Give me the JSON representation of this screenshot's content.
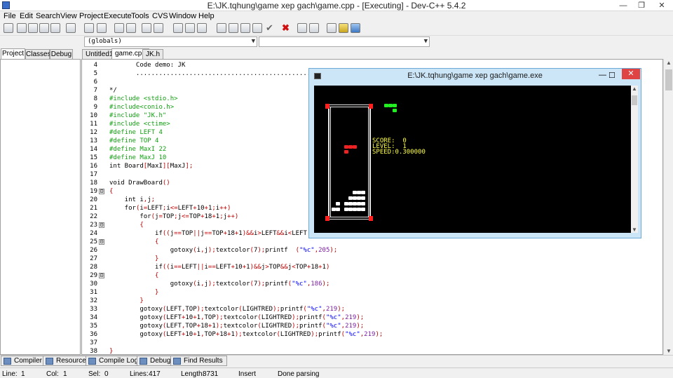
{
  "window": {
    "title": "E:\\JK.tqhung\\game xep gach\\game.cpp - [Executing] - Dev-C++ 5.4.2",
    "min": "—",
    "max": "❐",
    "close": "✕"
  },
  "menus": [
    "File",
    "Edit",
    "Search",
    "View",
    "Project",
    "Execute",
    "Tools",
    "CVS",
    "Window",
    "Help"
  ],
  "combos": {
    "scope": "(globals)",
    "members": ""
  },
  "left_tabs": [
    "Project",
    "Classes",
    "Debug"
  ],
  "editor_tabs": [
    "Untitled1",
    "game.cpp",
    "JK.h"
  ],
  "code_lines": [
    {
      "n": "4",
      "fold": "",
      "html": "       Code demo: JK"
    },
    {
      "n": "5",
      "fold": "",
      "html": "       ..............................................."
    },
    {
      "n": "6",
      "fold": "",
      "html": ""
    },
    {
      "n": "7",
      "fold": "",
      "html": "*/"
    },
    {
      "n": "8",
      "fold": "",
      "html": "<span class='pp'>#include &lt;stdio.h&gt;</span>"
    },
    {
      "n": "9",
      "fold": "",
      "html": "<span class='pp'>#include&lt;conio.h&gt;</span>"
    },
    {
      "n": "10",
      "fold": "",
      "html": "<span class='pp'>#include \"JK.h\"</span>"
    },
    {
      "n": "11",
      "fold": "",
      "html": "<span class='pp'>#include &lt;ctime&gt;</span>"
    },
    {
      "n": "12",
      "fold": "",
      "html": "<span class='pp'>#define LEFT 4</span>"
    },
    {
      "n": "13",
      "fold": "",
      "html": "<span class='pp'>#define TOP 4</span>"
    },
    {
      "n": "14",
      "fold": "",
      "html": "<span class='pp'>#define MaxI 22</span>"
    },
    {
      "n": "15",
      "fold": "",
      "html": "<span class='pp'>#define MaxJ 10</span>"
    },
    {
      "n": "16",
      "fold": "",
      "html": "int Board<span class='op'>[</span>MaxI<span class='op'>][</span>MaxJ<span class='op'>];</span>"
    },
    {
      "n": "17",
      "fold": "",
      "html": ""
    },
    {
      "n": "18",
      "fold": "",
      "html": "void DrawBoard<span class='op'>()</span>"
    },
    {
      "n": "19",
      "fold": "⊟",
      "html": "<span class='op'>{</span>"
    },
    {
      "n": "20",
      "fold": "",
      "html": "    int i<span class='op'>,</span>j<span class='op'>;</span>"
    },
    {
      "n": "21",
      "fold": "",
      "html": "    for<span class='op'>(</span>i<span class='op'>=</span>LEFT<span class='op'>;</span>i<span class='op'>&lt;=</span>LEFT<span class='op'>+</span>10<span class='op'>+</span>1<span class='op'>;</span>i<span class='op'>++)</span>"
    },
    {
      "n": "22",
      "fold": "",
      "html": "        for<span class='op'>(</span>j<span class='op'>=</span>TOP<span class='op'>;</span>j<span class='op'>&lt;=</span>TOP<span class='op'>+</span>18<span class='op'>+</span>1<span class='op'>;</span>j<span class='op'>++)</span>"
    },
    {
      "n": "23",
      "fold": "⊟",
      "html": "        <span class='op'>{</span>"
    },
    {
      "n": "24",
      "fold": "",
      "html": "            if<span class='op'>((</span>j<span class='op'>==</span>TOP<span class='op'>||</span>j<span class='op'>==</span>TOP<span class='op'>+</span>18<span class='op'>+</span>1<span class='op'>)&amp;&amp;</span>i<span class='op'>&gt;</span>LEFT<span class='op'>&amp;&amp;</span>i<span class='op'>&lt;</span>LEFT"
    },
    {
      "n": "25",
      "fold": "⊟",
      "html": "            <span class='op'>{</span>"
    },
    {
      "n": "26",
      "fold": "",
      "html": "                gotoxy<span class='op'>(</span>i<span class='op'>,</span>j<span class='op'>);</span>textcolor<span class='op'>(</span>7<span class='op'>);</span>printf  <span class='op'>(</span><span class='str'>\"%c\"</span><span class='op'>,</span><span class='num'>205</span><span class='op'>);</span>"
    },
    {
      "n": "27",
      "fold": "",
      "html": "            <span class='op'>}</span>"
    },
    {
      "n": "28",
      "fold": "",
      "html": "            if<span class='op'>((</span>i<span class='op'>==</span>LEFT<span class='op'>||</span>i<span class='op'>==</span>LEFT<span class='op'>+</span>10<span class='op'>+</span>1<span class='op'>)&amp;&amp;</span>j<span class='op'>&gt;</span>TOP<span class='op'>&amp;&amp;</span>j<span class='op'>&lt;</span>TOP<span class='op'>+</span>18<span class='op'>+</span>1<span class='op'>)</span>"
    },
    {
      "n": "29",
      "fold": "⊟",
      "html": "            <span class='op'>{</span>"
    },
    {
      "n": "30",
      "fold": "",
      "html": "                gotoxy<span class='op'>(</span>i<span class='op'>,</span>j<span class='op'>);</span>textcolor<span class='op'>(</span>7<span class='op'>);</span>printf<span class='op'>(</span><span class='str'>\"%c\"</span><span class='op'>,</span><span class='num'>186</span><span class='op'>);</span>"
    },
    {
      "n": "31",
      "fold": "",
      "html": "            <span class='op'>}</span>"
    },
    {
      "n": "32",
      "fold": "",
      "html": "        <span class='op'>}</span>"
    },
    {
      "n": "33",
      "fold": "",
      "html": "        gotoxy<span class='op'>(</span>LEFT<span class='op'>,</span>TOP<span class='op'>);</span>textcolor<span class='op'>(</span>LIGHTRED<span class='op'>);</span>printf<span class='op'>(</span><span class='str'>\"%c\"</span><span class='op'>,</span><span class='num'>219</span><span class='op'>);</span>"
    },
    {
      "n": "34",
      "fold": "",
      "html": "        gotoxy<span class='op'>(</span>LEFT<span class='op'>+</span>10<span class='op'>+</span>1<span class='op'>,</span>TOP<span class='op'>);</span>textcolor<span class='op'>(</span>LIGHTRED<span class='op'>);</span>printf<span class='op'>(</span><span class='str'>\"%c\"</span><span class='op'>,</span><span class='num'>219</span><span class='op'>);</span>"
    },
    {
      "n": "35",
      "fold": "",
      "html": "        gotoxy<span class='op'>(</span>LEFT<span class='op'>,</span>TOP<span class='op'>+</span>18<span class='op'>+</span>1<span class='op'>);</span>textcolor<span class='op'>(</span>LIGHTRED<span class='op'>);</span>printf<span class='op'>(</span><span class='str'>\"%c\"</span><span class='op'>,</span><span class='num'>219</span><span class='op'>);</span>"
    },
    {
      "n": "36",
      "fold": "",
      "html": "        gotoxy<span class='op'>(</span>LEFT<span class='op'>+</span>10<span class='op'>+</span>1<span class='op'>,</span>TOP<span class='op'>+</span>18<span class='op'>+</span>1<span class='op'>);</span>textcolor<span class='op'>(</span>LIGHTRED<span class='op'>);</span>printf<span class='op'>(</span><span class='str'>\"%c\"</span><span class='op'>,</span><span class='num'>219</span><span class='op'>);</span>"
    },
    {
      "n": "37",
      "fold": "",
      "html": ""
    },
    {
      "n": "38",
      "fold": "",
      "html": "<span class='op'>}</span>"
    }
  ],
  "console": {
    "title": "E:\\JK.tqhung\\game xep gach\\game.exe",
    "min": "—",
    "max": "☐",
    "close": "✕",
    "score_label": "SCORE:  0",
    "level_label": "LEVEL:  1",
    "speed_label": "SPEED:0.300000"
  },
  "bottom_tabs": [
    "Compiler",
    "Resources",
    "Compile Log",
    "Debug",
    "Find Results"
  ],
  "status": {
    "line_label": "Line:",
    "line": "1",
    "col_label": "Col:",
    "col": "1",
    "sel_label": "Sel:",
    "sel": "0",
    "lines_label": "Lines:",
    "lines": "417",
    "length_label": "Length:",
    "length": "8731",
    "mode": "Insert",
    "message": "Done parsing"
  }
}
